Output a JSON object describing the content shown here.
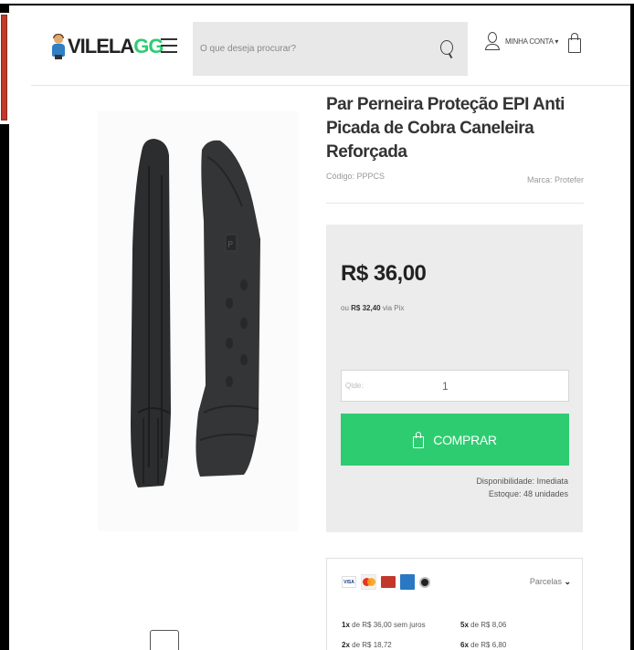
{
  "header": {
    "logo_text_a": "VILELA",
    "logo_text_b": "GG",
    "search_placeholder": "O que deseja procurar?",
    "account_label": "MINHA CONTA",
    "account_caret": "▾"
  },
  "product": {
    "title": "Par Perneira Proteção EPI Anti Picada de Cobra Caneleira Reforçada",
    "code": "Código: PPPCS",
    "brand": "Marca: Protefer",
    "price": "R$ 36,00",
    "pix_prefix": "ou",
    "pix_price": "R$ 32,40",
    "pix_suffix": "via Pix",
    "qty_label": "Qtde:",
    "qty_value": "1",
    "buy_label": "COMPRAR",
    "availability": "Disponibilidade: Imediata",
    "stock": "Estoque: 48 unidades"
  },
  "payment": {
    "cards": [
      "visa-icon",
      "mastercard-icon",
      "diners-icon",
      "amex-icon",
      "elo-icon"
    ],
    "visa_text": "VISA",
    "parcelas_label": "Parcelas",
    "installments": [
      {
        "n": "1x",
        "text": "de R$ 36,00 sem juros"
      },
      {
        "n": "5x",
        "text": "de R$ 8,06"
      },
      {
        "n": "2x",
        "text": "de R$ 18,72"
      },
      {
        "n": "6x",
        "text": "de R$ 6,80"
      }
    ]
  },
  "colors": {
    "accent": "#2ecc71",
    "price_box": "#ececec",
    "search_bg": "#e8e8e8"
  }
}
